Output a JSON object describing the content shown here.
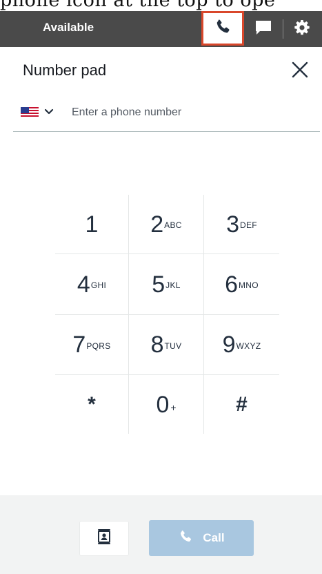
{
  "caption": {
    "text": "phone icon at the top to ope"
  },
  "header": {
    "status": "Available",
    "icons": {
      "phone": "phone-icon",
      "chat": "chat-icon",
      "settings": "gear-icon"
    },
    "colors": {
      "bar": "#4a4a4a",
      "highlight": "#d9472b"
    }
  },
  "panel": {
    "title": "Number pad",
    "close_icon": "close-icon"
  },
  "phone_input": {
    "country_flag": "us-flag-icon",
    "placeholder": "Enter a phone number",
    "value": ""
  },
  "keypad": {
    "keys": [
      {
        "digit": "1",
        "letters": ""
      },
      {
        "digit": "2",
        "letters": "ABC"
      },
      {
        "digit": "3",
        "letters": "DEF"
      },
      {
        "digit": "4",
        "letters": "GHI"
      },
      {
        "digit": "5",
        "letters": "JKL"
      },
      {
        "digit": "6",
        "letters": "MNO"
      },
      {
        "digit": "7",
        "letters": "PQRS"
      },
      {
        "digit": "8",
        "letters": "TUV"
      },
      {
        "digit": "9",
        "letters": "WXYZ"
      },
      {
        "digit": "*",
        "letters": ""
      },
      {
        "digit": "0",
        "letters": "+"
      },
      {
        "digit": "#",
        "letters": ""
      }
    ]
  },
  "footer": {
    "contacts_icon": "contacts-icon",
    "call_label": "Call",
    "call_icon": "phone-icon",
    "colors": {
      "call_button": "#a9c7e0",
      "background": "#f2f3f3"
    }
  }
}
